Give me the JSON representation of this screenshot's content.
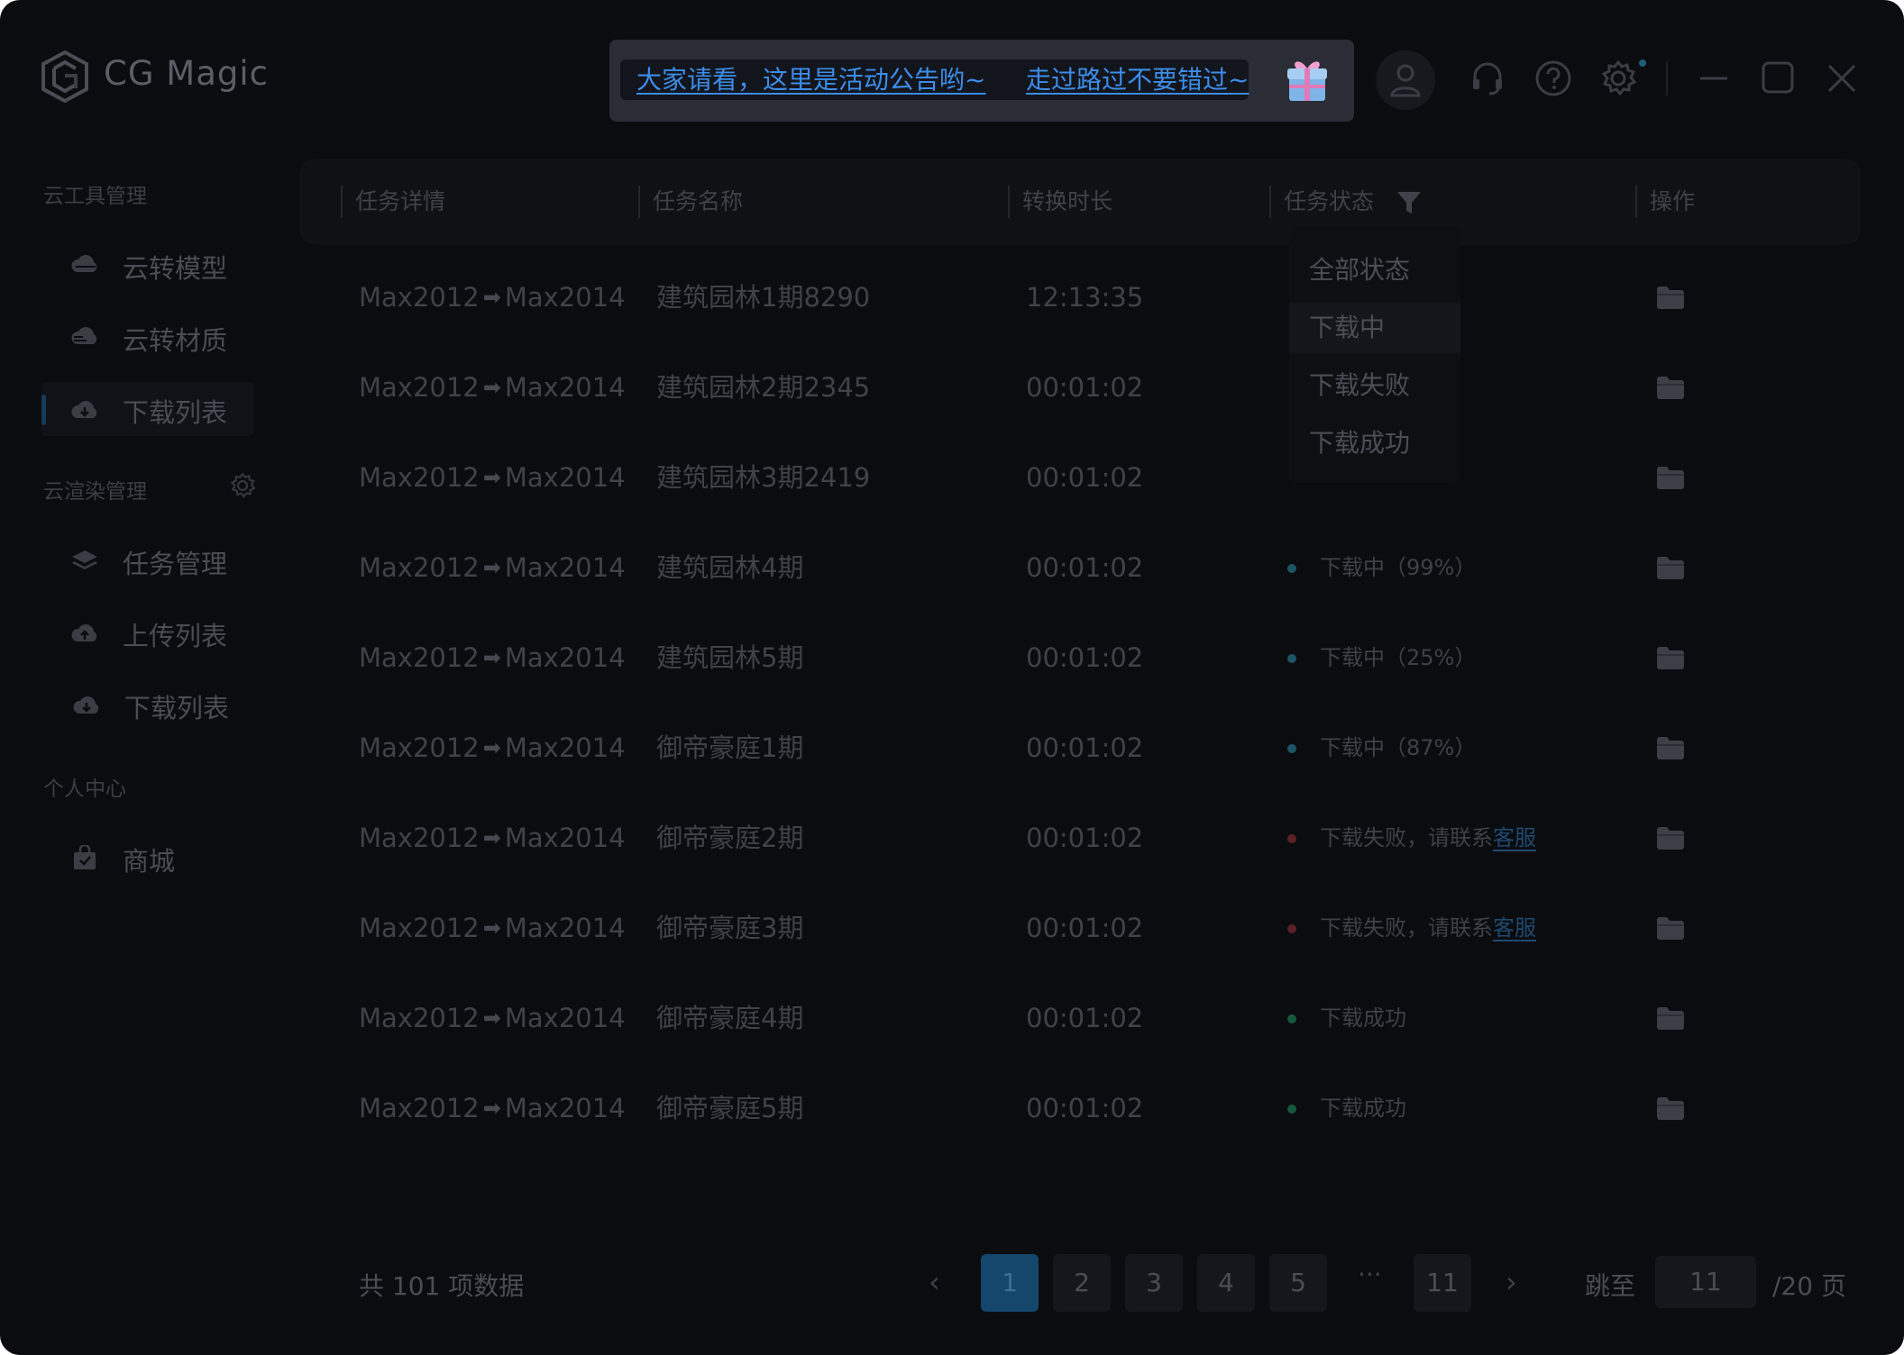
{
  "app": {
    "title": "CG Magic"
  },
  "announcement": {
    "part1": "大家请看，这里是活动公告哟~",
    "part2": "走过路过不要错过~"
  },
  "topbar_icons": [
    "user-icon",
    "headset-icon",
    "help-icon",
    "settings-icon",
    "minimize-icon",
    "maximize-icon",
    "close-icon"
  ],
  "sidebar": {
    "groups": [
      {
        "title": "云工具管理",
        "items": [
          {
            "label": "云转模型",
            "icon": "cloud-model-icon"
          },
          {
            "label": "云转材质",
            "icon": "cloud-material-icon"
          },
          {
            "label": "下载列表",
            "icon": "cloud-download-icon",
            "active": true
          }
        ]
      },
      {
        "title": "云渲染管理",
        "items": [
          {
            "label": "任务管理",
            "icon": "layers-icon"
          },
          {
            "label": "上传列表",
            "icon": "cloud-upload-icon"
          },
          {
            "label": "下载列表",
            "icon": "cloud-download-icon"
          }
        ]
      },
      {
        "title": "个人中心",
        "items": [
          {
            "label": "商城",
            "icon": "shopping-bag-icon"
          }
        ]
      }
    ]
  },
  "table": {
    "columns": [
      "任务详情",
      "任务名称",
      "转换时长",
      "任务状态",
      "操作"
    ],
    "rows": [
      {
        "from": "Max2012",
        "to": "Max2014",
        "name": "建筑园林1期8290",
        "duration": "12:13:35",
        "status": "",
        "status_type": "none",
        "link": ""
      },
      {
        "from": "Max2012",
        "to": "Max2014",
        "name": "建筑园林2期2345",
        "duration": "00:01:02",
        "status": "",
        "status_type": "none",
        "link": ""
      },
      {
        "from": "Max2012",
        "to": "Max2014",
        "name": "建筑园林3期2419",
        "duration": "00:01:02",
        "status": "",
        "status_type": "none",
        "link": ""
      },
      {
        "from": "Max2012",
        "to": "Max2014",
        "name": "建筑园林4期",
        "duration": "00:01:02",
        "status": "下载中（99%）",
        "status_type": "downloading",
        "link": ""
      },
      {
        "from": "Max2012",
        "to": "Max2014",
        "name": "建筑园林5期",
        "duration": "00:01:02",
        "status": "下载中（25%）",
        "status_type": "downloading",
        "link": ""
      },
      {
        "from": "Max2012",
        "to": "Max2014",
        "name": "御帝豪庭1期",
        "duration": "00:01:02",
        "status": "下载中（87%）",
        "status_type": "downloading",
        "link": ""
      },
      {
        "from": "Max2012",
        "to": "Max2014",
        "name": "御帝豪庭2期",
        "duration": "00:01:02",
        "status": "下载失败，请联系",
        "status_type": "failed",
        "link": "客服"
      },
      {
        "from": "Max2012",
        "to": "Max2014",
        "name": "御帝豪庭3期",
        "duration": "00:01:02",
        "status": "下载失败，请联系",
        "status_type": "failed",
        "link": "客服"
      },
      {
        "from": "Max2012",
        "to": "Max2014",
        "name": "御帝豪庭4期",
        "duration": "00:01:02",
        "status": "下载成功",
        "status_type": "success",
        "link": ""
      },
      {
        "from": "Max2012",
        "to": "Max2014",
        "name": "御帝豪庭5期",
        "duration": "00:01:02",
        "status": "下载成功",
        "status_type": "success",
        "link": ""
      }
    ]
  },
  "status_filter": {
    "options": [
      "全部状态",
      "下载中",
      "下载失败",
      "下载成功"
    ],
    "hovered": "下载中"
  },
  "pagination": {
    "total_text": "共 101 项数据",
    "pages": [
      "1",
      "2",
      "3",
      "4",
      "5"
    ],
    "ellipsis": "···",
    "last_page": "11",
    "current": "1",
    "prev": "‹",
    "next": "›",
    "jump_label": "跳至",
    "jump_value": "11",
    "total_pages_text": "/20 页"
  },
  "colors": {
    "downloading": "#1d5565",
    "failed": "#5a2227",
    "success": "#155a3a",
    "accent": "#15466b"
  }
}
